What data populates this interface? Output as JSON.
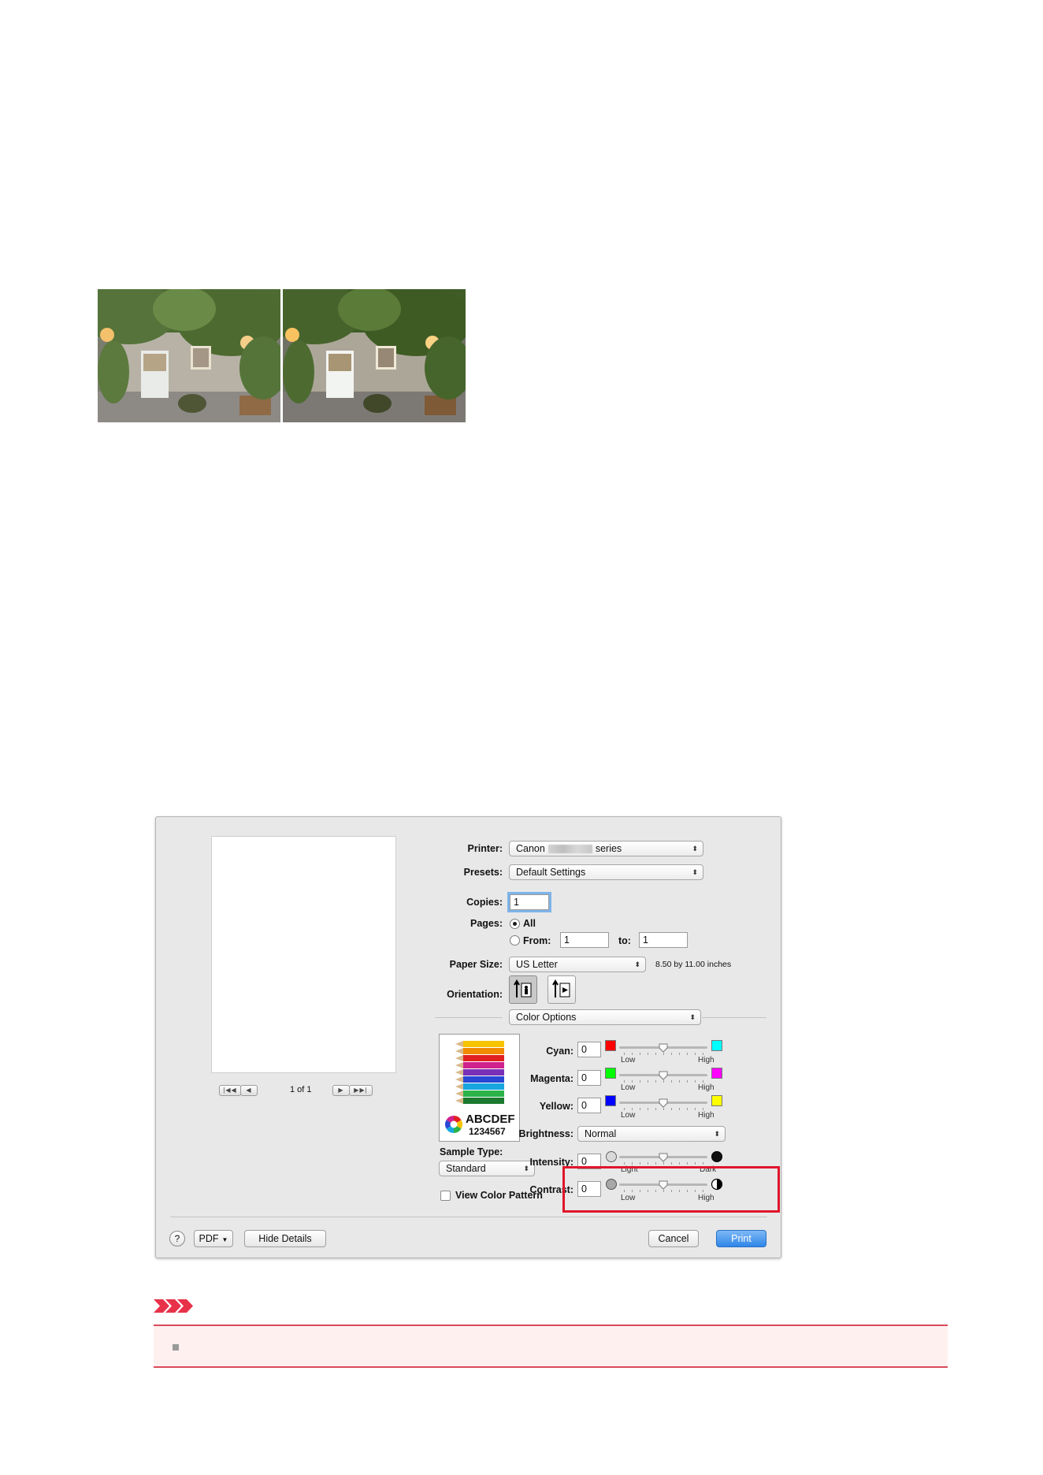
{
  "photos": [
    {
      "name": "photo-before",
      "desc": "ivy-covered house with lit lamps"
    },
    {
      "name": "photo-after",
      "desc": "ivy-covered house with lit lamps"
    }
  ],
  "dialog": {
    "printer": {
      "label": "Printer:",
      "value_prefix": "Canon",
      "value_suffix": "series"
    },
    "presets": {
      "label": "Presets:",
      "value": "Default Settings"
    },
    "copies": {
      "label": "Copies:",
      "value": "1"
    },
    "pages": {
      "label": "Pages:",
      "all": "All",
      "from_label": "From:",
      "from_value": "1",
      "to_label": "to:",
      "to_value": "1"
    },
    "paper_size": {
      "label": "Paper Size:",
      "value": "US Letter",
      "dimensions": "8.50 by 11.00 inches"
    },
    "orientation": {
      "label": "Orientation:"
    },
    "section": {
      "value": "Color Options"
    },
    "pager": {
      "text": "1 of 1",
      "first": "|◀◀",
      "prev": "◀",
      "next": "▶",
      "last": "▶▶|"
    },
    "sample": {
      "line1": "ABCDEF",
      "line2": "1234567",
      "type_label": "Sample Type:",
      "type_value": "Standard"
    },
    "view_color_pattern": "View Color Pattern",
    "cyan": {
      "label": "Cyan:",
      "value": "0",
      "low": "Low",
      "high": "High",
      "swatch_low": "#ff0000",
      "swatch_high": "#00ffff",
      "level": 0.5
    },
    "magenta": {
      "label": "Magenta:",
      "value": "0",
      "low": "Low",
      "high": "High",
      "swatch_low": "#00ff00",
      "swatch_high": "#ff00ff",
      "level": 0.5
    },
    "yellow": {
      "label": "Yellow:",
      "value": "0",
      "low": "Low",
      "high": "High",
      "swatch_low": "#0000ff",
      "swatch_high": "#ffff00",
      "level": 0.5
    },
    "brightness": {
      "label": "Brightness:",
      "value": "Normal"
    },
    "intensity": {
      "label": "Intensity:",
      "value": "0",
      "low": "Light",
      "high": "Dark",
      "level": 0.5
    },
    "contrast": {
      "label": "Contrast:",
      "value": "0",
      "low": "Low",
      "high": "High",
      "level": 0.5
    },
    "footer": {
      "help": "?",
      "pdf": "PDF",
      "hide_details": "Hide Details",
      "cancel": "Cancel",
      "print": "Print"
    }
  },
  "colors": {
    "highlight": "#e0162b",
    "important": "#d94a5b",
    "print_button": "#2f86e8"
  }
}
